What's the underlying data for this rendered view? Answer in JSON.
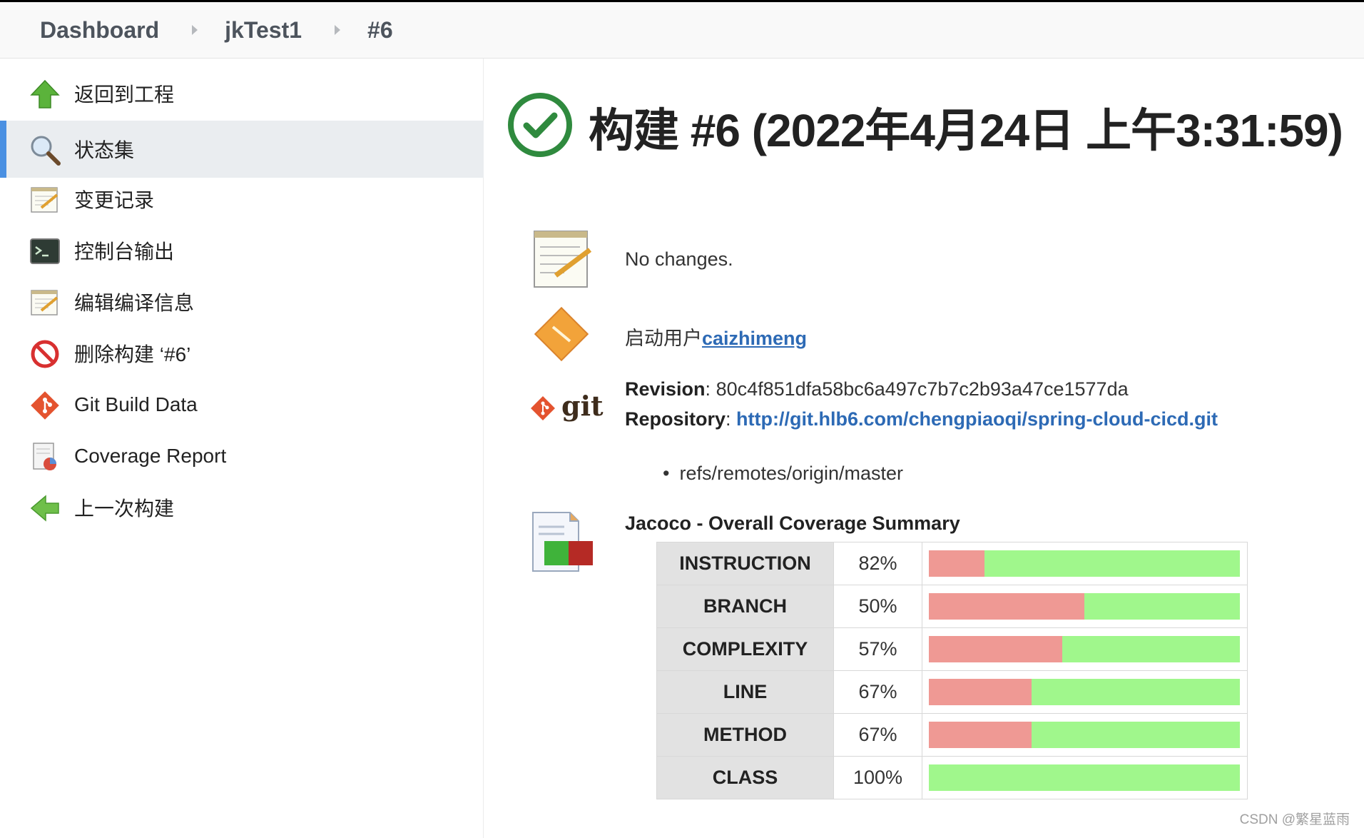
{
  "breadcrumb": [
    "Dashboard",
    "jkTest1",
    "#6"
  ],
  "sidebar": {
    "items": [
      {
        "label": "返回到工程",
        "icon": "up-arrow-icon"
      },
      {
        "label": "状态集",
        "icon": "search-icon",
        "active": true
      },
      {
        "label": "变更记录",
        "icon": "notepad-icon"
      },
      {
        "label": "控制台输出",
        "icon": "terminal-icon"
      },
      {
        "label": "编辑编译信息",
        "icon": "notepad-icon"
      },
      {
        "label": "删除构建 ‘#6’",
        "icon": "no-entry-icon"
      },
      {
        "label": "Git Build Data",
        "icon": "git-icon"
      },
      {
        "label": "Coverage Report",
        "icon": "coverage-report-icon"
      },
      {
        "label": "上一次构建",
        "icon": "left-arrow-icon"
      }
    ]
  },
  "build": {
    "title": "构建 #6 (2022年4月24日 上午3:31:59)",
    "status": "success"
  },
  "changes": {
    "text": "No changes."
  },
  "cause": {
    "prefix": "启动用户",
    "user": "caizhimeng"
  },
  "git": {
    "logo_text": "git",
    "revision_label": "Revision",
    "revision": "80c4f851dfa58bc6a497c7b7c2b93a47ce1577da",
    "repository_label": "Repository",
    "repository": "http://git.hlb6.com/chengpiaoqi/spring-cloud-cicd.git",
    "branches": [
      "refs/remotes/origin/master"
    ]
  },
  "jacoco": {
    "title": "Jacoco - Overall Coverage Summary",
    "rows": [
      {
        "metric": "INSTRUCTION",
        "percent": "82%",
        "covered_fraction": 0.82
      },
      {
        "metric": "BRANCH",
        "percent": "50%",
        "covered_fraction": 0.5
      },
      {
        "metric": "COMPLEXITY",
        "percent": "57%",
        "covered_fraction": 0.57
      },
      {
        "metric": "LINE",
        "percent": "67%",
        "covered_fraction": 0.67
      },
      {
        "metric": "METHOD",
        "percent": "67%",
        "covered_fraction": 0.67
      },
      {
        "metric": "CLASS",
        "percent": "100%",
        "covered_fraction": 1.0
      }
    ],
    "colors": {
      "covered": "#a0f78c",
      "missed": "#ef9994"
    }
  },
  "watermark": "CSDN @繁星蓝雨"
}
